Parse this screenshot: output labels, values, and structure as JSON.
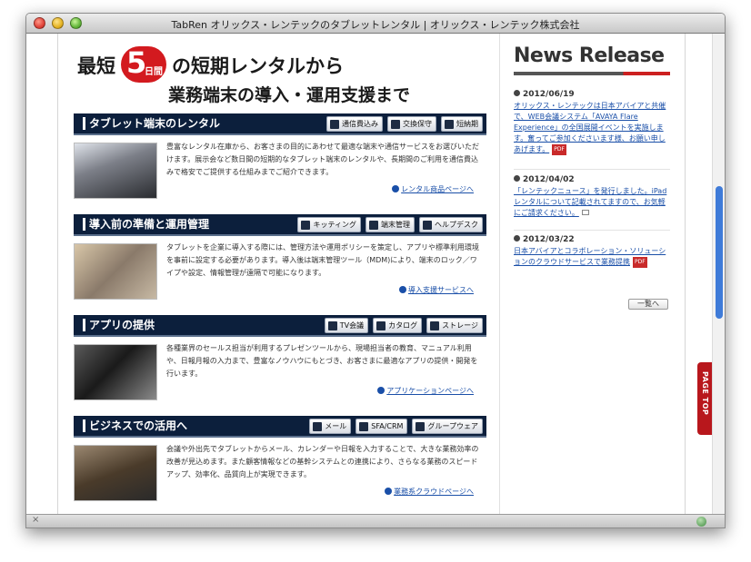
{
  "window": {
    "title": "TabRen オリックス・レンテックのタブレットレンタル | オリックス・レンテック株式会社"
  },
  "headline": {
    "part1": "最短",
    "badge_num": "5",
    "badge_unit": "日間",
    "part2": "の短期レンタルから",
    "line2": "業務端末の導入・運用支援まで"
  },
  "sections": [
    {
      "title": "タブレット端末のレンタル",
      "tags": [
        "通信費込み",
        "交換保守",
        "短納期"
      ],
      "description": "豊富なレンタル在庫から、お客さまの目的にあわせて最適な端末や通信サービスをお選びいただけます。展示会など数日間の短期的なタブレット端末のレンタルや、長期間のご利用を通信費込みで格安でご提供する仕組みまでご紹介できます。",
      "link": "レンタル商品ページへ"
    },
    {
      "title": "導入前の準備と運用管理",
      "tags": [
        "キッティング",
        "端末管理",
        "ヘルプデスク"
      ],
      "description": "タブレットを企業に導入する際には、管理方法や運用ポリシーを策定し、アプリや標準利用環境を事前に設定する必要があります。導入後は端末管理ツール（MDM)により、端末のロック／ワイプや設定、情報管理が遠隔で可能になります。",
      "link": "導入支援サービスへ"
    },
    {
      "title": "アプリの提供",
      "tags": [
        "TV会議",
        "カタログ",
        "ストレージ"
      ],
      "description": "各種業界のセールス担当が利用するプレゼンツールから、現場担当者の教育、マニュアル利用や、日報月報の入力まで、豊富なノウハウにもとづき、お客さまに最適なアプリの提供・開発を行います。",
      "link": "アプリケーションページへ"
    },
    {
      "title": "ビジネスでの活用へ",
      "tags": [
        "メール",
        "SFA/CRM",
        "グループウェア"
      ],
      "description": "会議や外出先でタブレットからメール、カレンダーや日報を入力することで、大きな業務効率の改善が見込めます。また顧客情報などの基幹システムとの連携により、さらなる業務のスピードアップ、効率化、品質向上が実現できます。",
      "link": "業務系クラウドページへ"
    }
  ],
  "news": {
    "title": "News Release",
    "items": [
      {
        "date": "2012/06/19",
        "text": "オリックス・レンテックは日本アバイアと共催で、WEB会議システム「AVAYA Flare Experience」の全国展開イベントを実施します。奮ってご参加くださいます様、お願い申しあげます。",
        "badge": "PDF"
      },
      {
        "date": "2012/04/02",
        "text": "「レンテックニュース」を発行しました。iPadレンタルについて記載されてますので、お気軽にご請求ください。",
        "badge": ""
      },
      {
        "date": "2012/03/22",
        "text": "日本アバイアとコラボレーション・ソリューションのクラウドサービスで業務提携",
        "badge": "PDF"
      }
    ],
    "more_label": "一覧へ"
  },
  "page_top": "PAGE TOP",
  "statusbar": {
    "left": "×"
  }
}
